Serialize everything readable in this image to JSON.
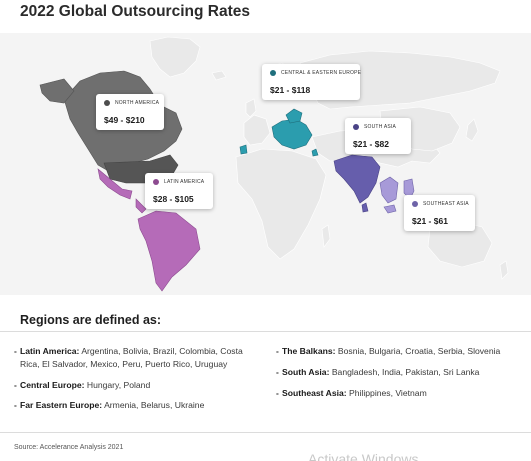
{
  "title": "2022 Global Outsourcing Rates",
  "chart_data": {
    "type": "map",
    "title": "2022 Global Outsourcing Rates",
    "regions": [
      {
        "name": "NORTH AMERICA",
        "range": "$49 - $210",
        "min": 49,
        "max": 210,
        "color": "#6f6f6f",
        "dot": "#4d4d4d"
      },
      {
        "name": "CENTRAL & EASTERN EUROPE",
        "range": "$21 - $118",
        "min": 21,
        "max": 118,
        "color": "#2b9dae",
        "dot": "#1f6f7d"
      },
      {
        "name": "SOUTH ASIA",
        "range": "$21 - $82",
        "min": 21,
        "max": 82,
        "color": "#665eac",
        "dot": "#4a4386"
      },
      {
        "name": "LATIN AMERICA",
        "range": "$28 - $105",
        "min": 28,
        "max": 105,
        "color": "#b56bb8",
        "dot": "#8d4b90"
      },
      {
        "name": "SOUTHEAST ASIA",
        "range": "$21 - $61",
        "min": 21,
        "max": 61,
        "color": "#a79ad8",
        "dot": "#6e63a8"
      }
    ]
  },
  "definitions": {
    "title": "Regions are defined as:",
    "left": [
      {
        "label": "Latin America:",
        "text": "Argentina, Bolivia, Brazil, Colombia, Costa Rica, El Salvador, Mexico, Peru, Puerto Rico, Uruguay"
      },
      {
        "label": "Central Europe:",
        "text": "Hungary, Poland"
      },
      {
        "label": "Far Eastern Europe:",
        "text": "Armenia, Belarus, Ukraine"
      }
    ],
    "right": [
      {
        "label": "The Balkans:",
        "text": "Bosnia, Bulgaria, Croatia, Serbia, Slovenia"
      },
      {
        "label": "South Asia:",
        "text": "Bangladesh, India, Pakistan, Sri Lanka"
      },
      {
        "label": "Southeast Asia:",
        "text": "Philippines, Vietnam"
      }
    ]
  },
  "source": "Source: Accelerance Analysis 2021",
  "watermark": "Activate Windows"
}
